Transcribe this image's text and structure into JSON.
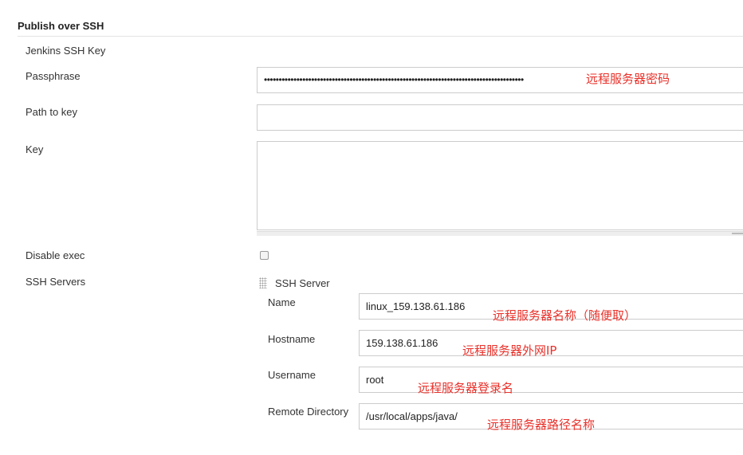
{
  "section": {
    "title": "Publish over SSH"
  },
  "fields": {
    "jenkins_ssh_key_label": "Jenkins SSH Key",
    "passphrase_label": "Passphrase",
    "passphrase_value": "••••••••••••••••••••••••••••••••••••••••••••••••••••••••••••••••••••••••••••••••••••••••",
    "passphrase_note": "远程服务器密码",
    "path_to_key_label": "Path to key",
    "path_to_key_value": "",
    "key_label": "Key",
    "key_value": "",
    "disable_exec_label": "Disable exec",
    "ssh_servers_label": "SSH Servers"
  },
  "ssh_server": {
    "title": "SSH Server",
    "name_label": "Name",
    "name_value": "linux_159.138.61.186",
    "name_note": "远程服务器名称（随便取）",
    "hostname_label": "Hostname",
    "hostname_value": "159.138.61.186",
    "hostname_note": "远程服务器外网IP",
    "username_label": "Username",
    "username_value": "root",
    "username_note": "远程服务器登录名",
    "remote_dir_label": "Remote Directory",
    "remote_dir_value": "/usr/local/apps/java/",
    "remote_dir_note": "远程服务器路径名称"
  },
  "colors": {
    "annotation": "#e8312a",
    "border": "#cccccc"
  }
}
